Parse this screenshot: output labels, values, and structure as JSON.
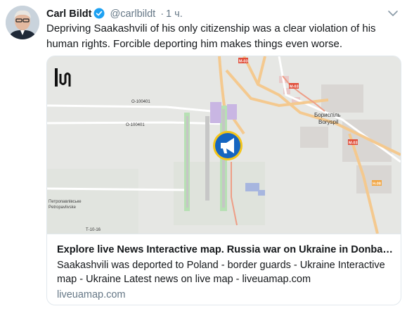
{
  "tweet": {
    "author_name": "Carl Bildt",
    "handle": "@carlbildt",
    "separator": "·",
    "time": "1 ч.",
    "text": "Depriving Saakashvili of his only citizenship was a clear violation of his human rights. Forcible deporting him makes things even worse."
  },
  "card": {
    "title": "Explore live News Interactive map. Russia war on Ukraine in Donbas ...",
    "description": "Saakashvili was deported to Poland - border guards - Ukraine Interactive map - Ukraine Latest news on live map - liveuamap.com",
    "domain": "liveuamap.com",
    "map": {
      "road_labels": [
        "О-100401",
        "О-100401",
        "Т-10-16",
        "М-03",
        "М-03",
        "М-03",
        "Н-08"
      ],
      "city_label_1": "Бориспіль",
      "city_label_2": "Boryspil",
      "village_label_1": "Петропавлівське",
      "village_label_2": "Petropavlivske"
    }
  },
  "colors": {
    "verified": "#1da1f2",
    "marker_bg": "#1565c0",
    "marker_ring": "#f5c518",
    "secondary_text": "#657786"
  },
  "icons": [
    "verified-badge-icon",
    "chevron-down-icon",
    "liveuamap-logo",
    "megaphone-icon"
  ]
}
